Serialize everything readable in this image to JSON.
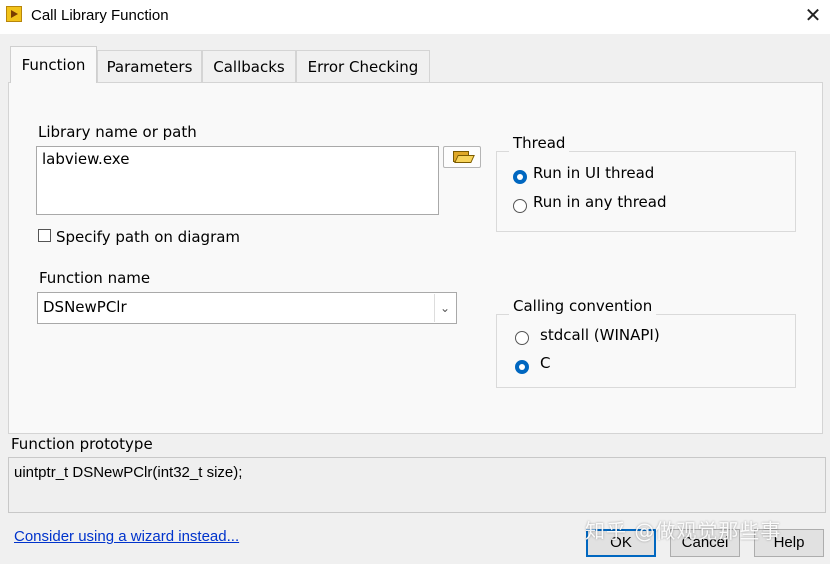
{
  "window": {
    "title": "Call Library Function",
    "close_glyph": "✕",
    "app_icon": "labview-icon"
  },
  "tabs": [
    {
      "label": "Function",
      "active": true
    },
    {
      "label": "Parameters",
      "active": false
    },
    {
      "label": "Callbacks",
      "active": false
    },
    {
      "label": "Error Checking",
      "active": false
    }
  ],
  "library": {
    "label": "Library name or path",
    "value": "labview.exe",
    "browse_icon": "folder-icon",
    "specify_path_label": "Specify path on diagram",
    "specify_path_checked": false
  },
  "function_name": {
    "label": "Function name",
    "value": "DSNewPClr",
    "dropdown_glyph": "⌄"
  },
  "thread": {
    "title": "Thread",
    "options": [
      {
        "label": "Run in UI thread",
        "selected": true
      },
      {
        "label": "Run in any thread",
        "selected": false
      }
    ]
  },
  "calling_convention": {
    "title": "Calling convention",
    "options": [
      {
        "label": "stdcall (WINAPI)",
        "selected": false
      },
      {
        "label": "C",
        "selected": true
      }
    ]
  },
  "prototype": {
    "label": "Function prototype",
    "value": "uintptr_t DSNewPClr(int32_t size);"
  },
  "footer": {
    "wizard_link": "Consider using a wizard instead...",
    "ok_label": "OK",
    "cancel_label": "Cancel",
    "help_label": "Help"
  },
  "watermark": "知乎 @做观觉那些事",
  "colors": {
    "accent": "#0067c0",
    "link": "#0033cc",
    "panel": "#f9f9f9",
    "background": "#f0f0f0"
  }
}
